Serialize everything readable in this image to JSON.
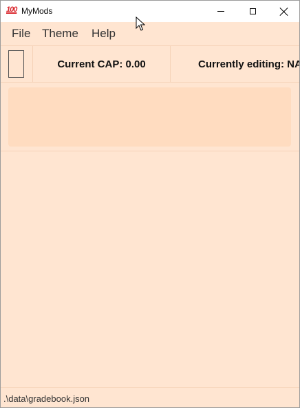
{
  "window": {
    "title": "MyMods",
    "app_icon_text": "100",
    "controls": {
      "minimize": "minimize",
      "maximize": "maximize",
      "close": "close"
    }
  },
  "menu": {
    "items": [
      "File",
      "Theme",
      "Help"
    ]
  },
  "toolbar": {
    "cap_text": "Current CAP: 0.00",
    "editing_text": "Currently editing: NA"
  },
  "status": {
    "path": ".\\data\\gradebook.json"
  },
  "colors": {
    "background": "#ffe5d1",
    "panel": "#ffdcc0",
    "divider": "#f5d2b7"
  }
}
